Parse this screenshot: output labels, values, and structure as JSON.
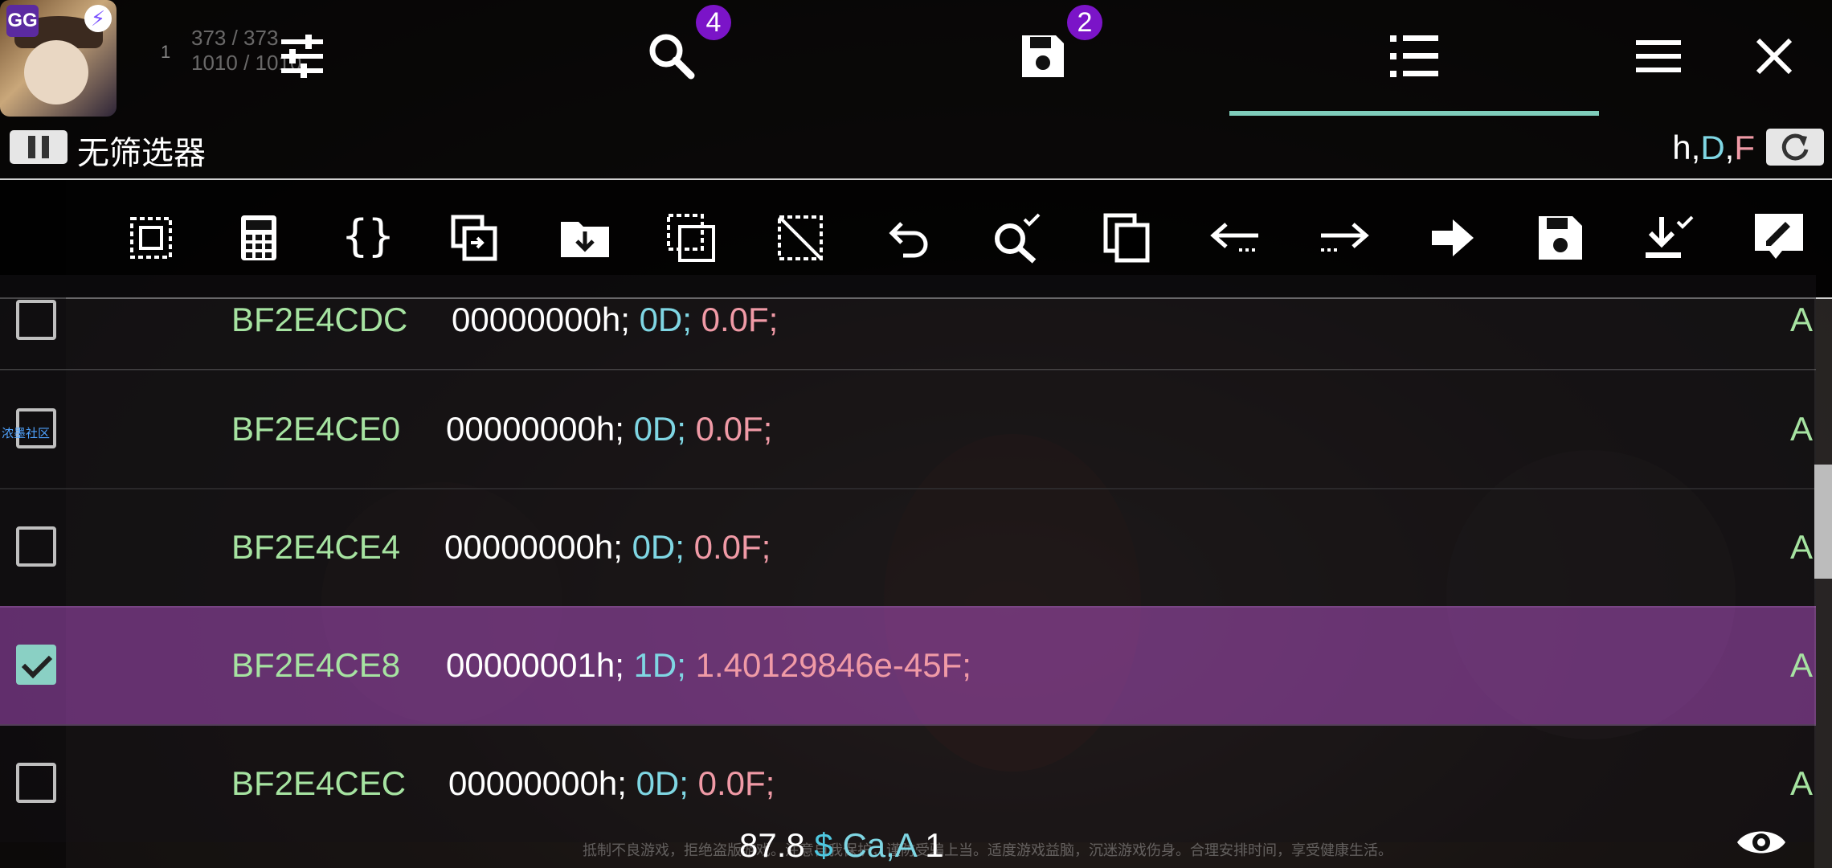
{
  "header": {
    "search_badge": "4",
    "saved_badge": "2",
    "filter_label": "无筛选器",
    "type_flags": {
      "h": "h",
      "comma1": ",",
      "d": "D",
      "comma2": ",",
      "f": "F"
    }
  },
  "colors": {
    "accent": "#7fcdbb",
    "badge": "#7b14c8",
    "address": "#a6e3a1",
    "dword": "#7fd6e3",
    "float": "#f09aa6",
    "selected_row": "#9646aa"
  },
  "toolbar_icons": [
    "select-all-icon",
    "calculator-icon",
    "braces-icon",
    "copy-to-icon",
    "folder-download-icon",
    "select-invert-icon",
    "deselect-icon",
    "undo-icon",
    "search-check-icon",
    "copy-icon",
    "arrow-left-icon",
    "arrow-right-icon",
    "goto-arrow-icon",
    "save-icon",
    "download-check-icon",
    "edit-icon"
  ],
  "rows": [
    {
      "address": "BF2E4CDC",
      "hex": "00000000h;",
      "dword": "0D;",
      "float": "0.0F;",
      "flag": "A",
      "checked": false
    },
    {
      "address": "BF2E4CE0",
      "hex": "00000000h;",
      "dword": "0D;",
      "float": "0.0F;",
      "flag": "A",
      "checked": false
    },
    {
      "address": "BF2E4CE4",
      "hex": "00000000h;",
      "dword": "0D;",
      "float": "0.0F;",
      "flag": "A",
      "checked": false
    },
    {
      "address": "BF2E4CE8",
      "hex": "00000001h;",
      "dword": "1D;",
      "float": "1.40129846e-45F;",
      "flag": "A",
      "checked": true
    },
    {
      "address": "BF2E4CEC",
      "hex": "00000000h;",
      "dword": "0D;",
      "float": "0.0F;",
      "flag": "A",
      "checked": false
    }
  ],
  "side_label": "浓墨社区",
  "status": {
    "value": "87.8",
    "currency": "$",
    "flags": "Ca,A",
    "count": "1"
  },
  "notice": "抵制不良游戏，拒绝盗版游戏。注意自我保护，谨防受骗上当。适度游戏益脑，沉迷游戏伤身。合理安排时间，享受健康生活。",
  "game_hud": {
    "hp": "373 / 373",
    "mp": "1010 / 1010",
    "level": "1"
  }
}
